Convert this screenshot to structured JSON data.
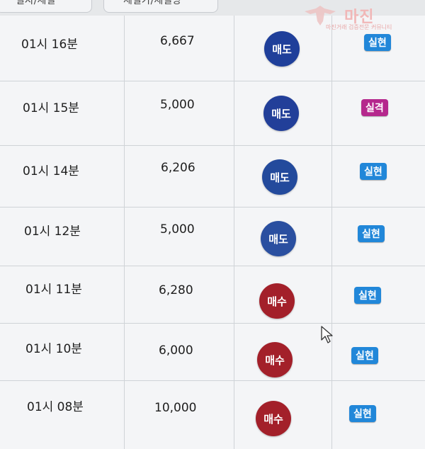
{
  "header": {
    "tab1_label": "일자/체결",
    "tab2_label": "체결가/체결량"
  },
  "watermark": {
    "brand": "마진",
    "sub": "마진거래 검증전문 커뮤니티"
  },
  "colors": {
    "sell": "#1f3f9a",
    "buy": "#a3202a",
    "realized": "#2187d9",
    "liquidated": "#b5288d"
  },
  "rows": [
    {
      "time": "01시 16분",
      "amount": "6,667",
      "side": "매도",
      "status": "실현"
    },
    {
      "time": "01시 15분",
      "amount": "5,000",
      "side": "매도",
      "status": "실격"
    },
    {
      "time": "01시 14분",
      "amount": "6,206",
      "side": "매도",
      "status": "실현"
    },
    {
      "time": "01시 12분",
      "amount": "5,000",
      "side": "매도",
      "status": "실현"
    },
    {
      "time": "01시 11분",
      "amount": "6,280",
      "side": "매수",
      "status": "실현"
    },
    {
      "time": "01시 10분",
      "amount": "6,000",
      "side": "매수",
      "status": "실현"
    },
    {
      "time": "01시 08분",
      "amount": "10,000",
      "side": "매수",
      "status": "실현"
    }
  ]
}
